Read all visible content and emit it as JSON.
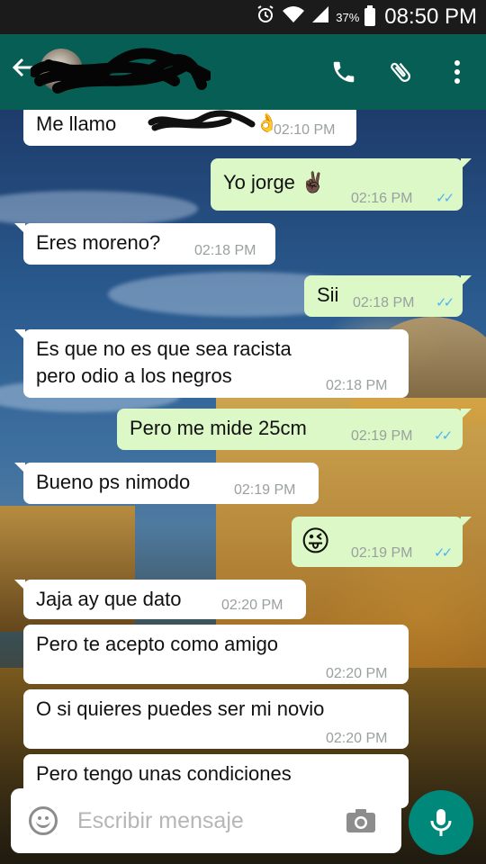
{
  "status_bar": {
    "battery_percent": "37%",
    "time": "08:50 PM",
    "icons": [
      "alarm-icon",
      "wifi-icon",
      "signal-icon",
      "battery-icon"
    ]
  },
  "header": {
    "contact_name": "",
    "actions": [
      "call-icon",
      "attach-icon",
      "more-icon"
    ]
  },
  "messages": [
    {
      "dir": "in",
      "text": "Me llamo",
      "time": "02:10 PM",
      "note": "name and emoji redacted with scribble"
    },
    {
      "dir": "out",
      "text": "Yo jorge ✌🏿",
      "time": "02:16 PM",
      "read": true
    },
    {
      "dir": "in",
      "text": "Eres moreno?",
      "time": "02:18 PM"
    },
    {
      "dir": "out",
      "text": "Sii",
      "time": "02:18 PM",
      "read": true
    },
    {
      "dir": "in",
      "text": "Es que no es que sea racista pero odio a los negros",
      "time": "02:18 PM"
    },
    {
      "dir": "out",
      "text": "Pero me mide 25cm",
      "time": "02:19 PM",
      "read": true
    },
    {
      "dir": "in",
      "text": "Bueno ps nimodo",
      "time": "02:19 PM"
    },
    {
      "dir": "out",
      "text": "😜",
      "time": "02:19 PM",
      "read": true
    },
    {
      "dir": "in",
      "text": "Jaja ay que dato",
      "time": "02:20 PM"
    },
    {
      "dir": "in",
      "text": "Pero te acepto como amigo",
      "time": "02:20 PM"
    },
    {
      "dir": "in",
      "text": "O si quieres puedes ser mi novio",
      "time": "02:20 PM"
    },
    {
      "dir": "in",
      "text": "Pero tengo unas condiciones",
      "time": ""
    }
  ],
  "composer": {
    "placeholder": "Escribir mensaje"
  },
  "colors": {
    "header": "#075e54",
    "outgoing_bubble": "#dcf8c6",
    "incoming_bubble": "#ffffff",
    "read_ticks": "#4fb3f6",
    "mic_button": "#00897b"
  }
}
